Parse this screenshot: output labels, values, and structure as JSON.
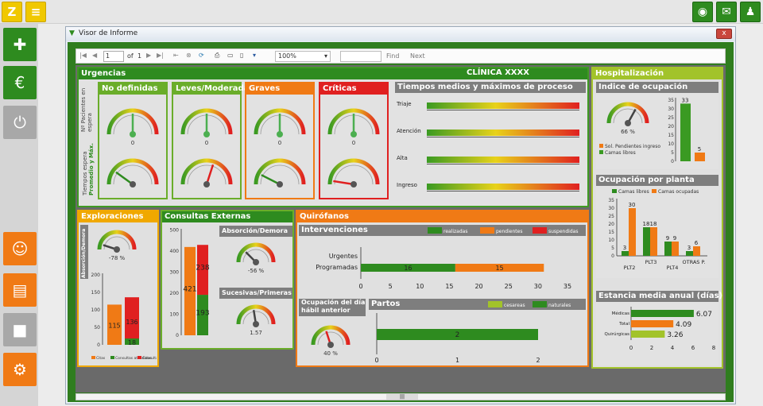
{
  "app": {
    "top_left_icons": [
      "zeta-logo-icon",
      "edit-report-icon"
    ],
    "top_right_icons": [
      "user-alert-icon",
      "mail-icon",
      "users-icon"
    ]
  },
  "window": {
    "title": "Visor de Informe",
    "close": "x"
  },
  "toolbar": {
    "page": "1",
    "of": "of",
    "total": "1",
    "zoom": "100%",
    "find": "Find",
    "next": "Next"
  },
  "report": {
    "clinic": "CLÍNICA XXXX",
    "urgencias": {
      "title": "Urgencias",
      "row1": "Nº Pacientes en espera",
      "row2a": "Tiempos espera",
      "row2b": "Promedio y Máx.",
      "cols": [
        {
          "name": "No definidas",
          "v1": "0",
          "c": "#6aad2a"
        },
        {
          "name": "Leves/Moderadas",
          "v1": "0",
          "c": "#6aad2a"
        },
        {
          "name": "Graves",
          "v1": "0",
          "c": "#f07a15"
        },
        {
          "name": "Críticas",
          "v1": "0",
          "c": "#e02020"
        }
      ],
      "tiempos": {
        "title": "Tiempos medios y máximos de proceso",
        "rows": [
          "Triaje",
          "Atención",
          "Alta",
          "Ingreso"
        ]
      }
    },
    "hosp": {
      "title": "Hospitalización",
      "ocup": {
        "title": "Indice de ocupación",
        "gauge": "66 %",
        "ticks": [
          "0",
          "5",
          "10",
          "15",
          "20",
          "25",
          "30",
          "35"
        ],
        "bars": [
          {
            "label": "33",
            "value": 33,
            "c": "#3a9a22"
          },
          {
            "label": "5",
            "value": 5,
            "c": "#f07a15"
          }
        ],
        "legend": [
          "Sol. Pendientes ingreso",
          "Camas libres"
        ]
      },
      "planta": {
        "title": "Ocupación por planta",
        "legend": [
          "Camas libres",
          "Camas ocupadas"
        ],
        "ticks": [
          "0",
          "5",
          "10",
          "15",
          "20",
          "25",
          "30",
          "35"
        ],
        "groups": [
          {
            "name": "PLT2",
            "libres": 3,
            "ocupadas": 30
          },
          {
            "name": "PLT3",
            "libres": 18,
            "ocupadas": 18
          },
          {
            "name": "PLT4",
            "libres": 9,
            "ocupadas": 9
          },
          {
            "name": "OTRAS P.",
            "libres": 3,
            "ocupadas": 6
          }
        ],
        "xlabels": [
          "PLT2",
          "PLT3",
          "PLT4",
          "OTRAS P."
        ]
      },
      "estancia": {
        "title": "Estancia media anual (días)",
        "rows": [
          {
            "label": "Médicas",
            "value": 6.07,
            "text": "6.07",
            "c": "#2e8b1f"
          },
          {
            "label": "Total",
            "value": 4.09,
            "text": "4.09",
            "c": "#f07a15"
          },
          {
            "label": "Quirúrgicas",
            "value": 3.26,
            "text": "3.26",
            "c": "#a2c32a"
          }
        ],
        "ticks": [
          "0",
          "2",
          "4",
          "6",
          "8"
        ]
      }
    },
    "explor": {
      "title": "Exploraciones",
      "side": "Absorción/Demora",
      "gauge": "-78 %",
      "ticks": [
        "0",
        "50",
        "100",
        "150",
        "200"
      ],
      "bars": [
        {
          "v": 115,
          "c": "#f07a15",
          "label": "115"
        },
        {
          "v": 136,
          "c": "#e02020",
          "label": "136"
        },
        {
          "v": 18,
          "c": "#2e8b1f",
          "label": "18"
        }
      ],
      "legend": [
        "Citas",
        "Consultas atendidas",
        "Consultas pendientes"
      ]
    },
    "consultas": {
      "title": "Consultas Externas",
      "ticks": [
        "0",
        "100",
        "200",
        "300",
        "400",
        "500"
      ],
      "orange": 421,
      "green": 193,
      "red": 238,
      "orange_label": "421",
      "green_label": "193",
      "red_label": "238",
      "abs": {
        "title": "Absorción/Demora",
        "value": "-56 %"
      },
      "suc": {
        "title": "Sucesivas/Primeras",
        "value": "1.57"
      }
    },
    "quir": {
      "title": "Quirófanos",
      "interv": {
        "title": "Intervenciones",
        "legend": [
          "realizadas",
          "pendientes",
          "suspendidas"
        ],
        "rows": [
          "Urgentes",
          "Programadas"
        ],
        "realizadas": 16,
        "pendientes": 15,
        "realizadas_label": "16",
        "pendientes_label": "15",
        "ticks": [
          "0",
          "5",
          "10",
          "15",
          "20",
          "25",
          "30",
          "35"
        ]
      },
      "ocup": {
        "title": "Ocupación del día hábil anterior",
        "value": "40 %"
      },
      "partos": {
        "title": "Partos",
        "legend": [
          "cesareas",
          "naturales"
        ],
        "value": 2,
        "value_label": "2",
        "ticks": [
          "0",
          "1",
          "2"
        ]
      }
    }
  },
  "colors": {
    "green": "#2e8b1f",
    "orange": "#f07a15",
    "red": "#e02020",
    "lime": "#a2c32a",
    "grey": "#7e7e7e"
  }
}
